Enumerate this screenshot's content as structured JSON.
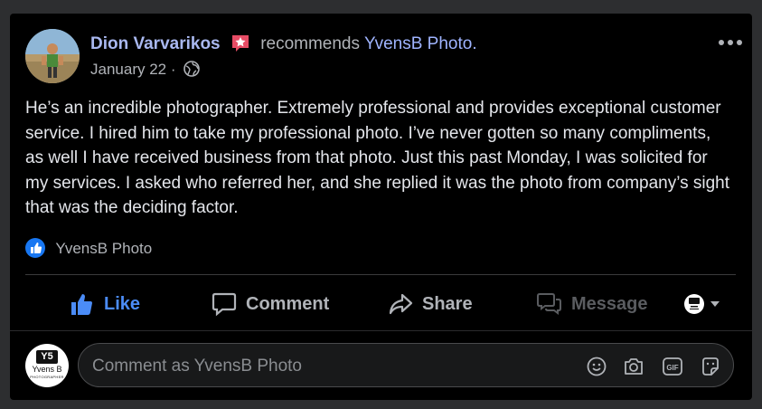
{
  "post": {
    "author": "Dion Varvarikos",
    "recommends_text": "recommends",
    "page_name": "YvensB Photo.",
    "date": "January 22 ·",
    "body": "He’s an incredible photographer. Extremely professional and provides exceptional customer service. I hired him to take my professional photo. I’ve never gotten so many compliments, as well I have received business from that photo. Just this past Monday, I was solicited for my services. I asked who referred her, and she replied it was the photo from company’s sight that was the deciding factor."
  },
  "reactions": {
    "liked_by": "YvensB Photo"
  },
  "actions": {
    "like": "Like",
    "comment": "Comment",
    "share": "Share",
    "message": "Message"
  },
  "comment_box": {
    "placeholder": "Comment as YvensB Photo",
    "logo_mark": "Y5",
    "logo_name": "Yvens B",
    "logo_sub": "PHOTOGRAPHER"
  },
  "colors": {
    "background": "#2d2e30",
    "card": "#000000",
    "like_blue": "#4b8cf7",
    "author_link": "#a9b8f0",
    "text": "#e4e6eb",
    "muted": "#b0b3b8"
  },
  "icons": [
    "star-badge-icon",
    "globe-icon",
    "more-options-icon",
    "like-thumb-icon",
    "comment-bubble-icon",
    "share-arrow-icon",
    "message-icon",
    "emoji-icon",
    "camera-icon",
    "gif-icon",
    "sticker-icon",
    "chevron-down-icon"
  ]
}
